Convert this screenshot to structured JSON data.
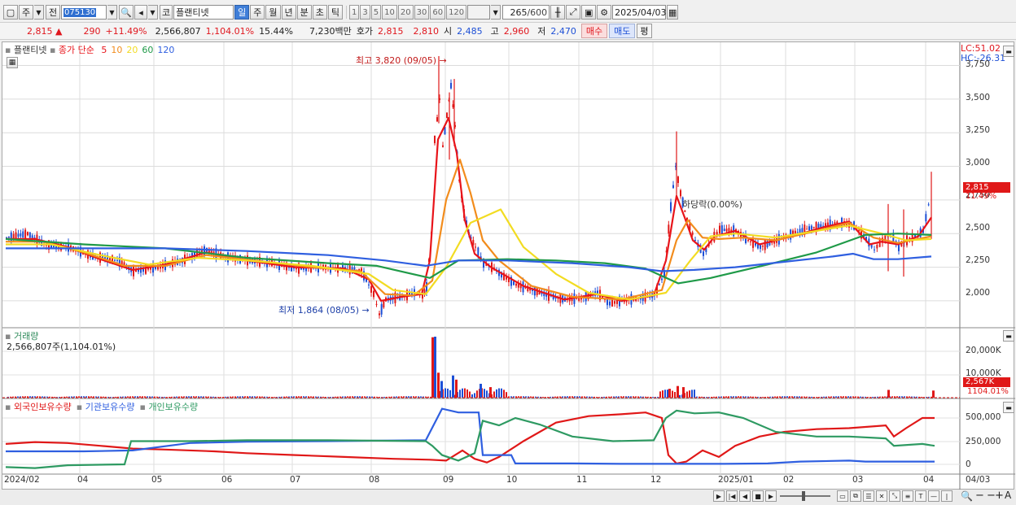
{
  "toolbar": {
    "period_short": "주",
    "prev_label": "전",
    "code": "075130",
    "market_badge": "코",
    "stock_name": "플랜티넷",
    "timeframes": [
      "일",
      "주",
      "월",
      "년",
      "분",
      "초",
      "틱"
    ],
    "active_timeframe": "일",
    "intervals": [
      "1",
      "3",
      "5",
      "10",
      "20",
      "30",
      "60",
      "120"
    ],
    "count": "265",
    "count_total": "/600",
    "date": "2025/04/03"
  },
  "quote": {
    "price": "2,815",
    "change_arrow": "▲",
    "change": "290",
    "change_pct": "+11.49%",
    "volume": "2,566,807",
    "volume_pct": "1,104.01%",
    "turnover_pct": "15.44%",
    "amount": "7,230백만",
    "hoga_label": "호가",
    "ask": "2,815",
    "bid": "2,810",
    "open_label": "시",
    "open": "2,485",
    "high_label": "고",
    "high": "2,960",
    "low_label": "저",
    "low": "2,470",
    "buy_label": "매수",
    "sell_label": "매도",
    "avg_label": "평"
  },
  "price_panel": {
    "legend_name": "플랜티넷",
    "legend_series": "종가 단순",
    "ma_periods": [
      "5",
      "10",
      "20",
      "60",
      "120"
    ],
    "ma_colors": [
      "#e8141a",
      "#f28c1c",
      "#f2dc22",
      "#1f9a48",
      "#2f5fe0"
    ],
    "lc_label": "LC:51.02",
    "hc_label": "HC:-26.31",
    "high_annot": "최고 3,820 (09/05)",
    "low_annot": "최저 1,864 (08/05)",
    "mid_annot": "하당락(0.00%)",
    "last_price_badge": "2,815",
    "last_pct_badge": "11.49%",
    "y_ticks": [
      "3,750",
      "3,500",
      "3,250",
      "3,000",
      "2,750",
      "2,500",
      "2,250",
      "2,000"
    ]
  },
  "volume_panel": {
    "title": "거래량",
    "value": "2,566,807주(1,104.01%)",
    "y_ticks": [
      "20,000K",
      "10,000K"
    ],
    "last_badge": "2,567K",
    "last_pct_badge": "1104.01%"
  },
  "flow_panel": {
    "legend": [
      "외국인보유수량",
      "기관보유수량",
      "개인보유수량"
    ],
    "colors": [
      "#e01818",
      "#2f5fe0",
      "#2e9a62"
    ],
    "y_ticks": [
      "500,000",
      "250,000",
      "0"
    ]
  },
  "x_axis": {
    "labels": [
      "2024/02",
      "04",
      "05",
      "06",
      "07",
      "08",
      "09",
      "10",
      "11",
      "12",
      "2025/01",
      "02",
      "03",
      "04",
      "04/03"
    ]
  },
  "chart_data": {
    "type": "candlestick",
    "title": "",
    "symbol": "075130",
    "name": "플랜티넷",
    "x_range": [
      "2024/02",
      "2025/04/03"
    ],
    "ylim": [
      1800,
      3850
    ],
    "highest": {
      "value": 3820,
      "date": "09/05"
    },
    "lowest": {
      "value": 1864,
      "date": "08/05"
    },
    "last_close": 2815,
    "close_series_monthly": [
      {
        "x": "2024/02",
        "close": 2480
      },
      {
        "x": "04",
        "close": 2350
      },
      {
        "x": "05",
        "close": 2260
      },
      {
        "x": "06",
        "close": 2330
      },
      {
        "x": "07",
        "close": 2250
      },
      {
        "x": "08",
        "close": 2000
      },
      {
        "x": "09",
        "close": 3350
      },
      {
        "x": "10",
        "close": 2200
      },
      {
        "x": "11",
        "close": 2000
      },
      {
        "x": "12",
        "close": 2700
      },
      {
        "x": "2025/01",
        "close": 2420
      },
      {
        "x": "02",
        "close": 2510
      },
      {
        "x": "03",
        "close": 2580
      },
      {
        "x": "04/03",
        "close": 2815
      }
    ],
    "moving_averages": [
      "5",
      "10",
      "20",
      "60",
      "120"
    ],
    "volume_peak_K": 22000,
    "flow_series": [
      {
        "name": "외국인보유수량",
        "approx": [
          230000,
          200000,
          150000,
          120000,
          80000,
          50000,
          30000,
          100000,
          350000,
          550000,
          180000,
          320000,
          420000,
          500000
        ]
      },
      {
        "name": "기관보유수량",
        "approx": [
          140000,
          150000,
          170000,
          240000,
          250000,
          260000,
          600000,
          80000,
          10000,
          5000,
          10000,
          30000,
          40000,
          40000
        ]
      },
      {
        "name": "개인보유수량",
        "approx": [
          -30000,
          10000,
          250000,
          260000,
          260000,
          270000,
          150000,
          480000,
          250000,
          500000,
          420000,
          280000,
          300000,
          200000
        ]
      }
    ]
  }
}
